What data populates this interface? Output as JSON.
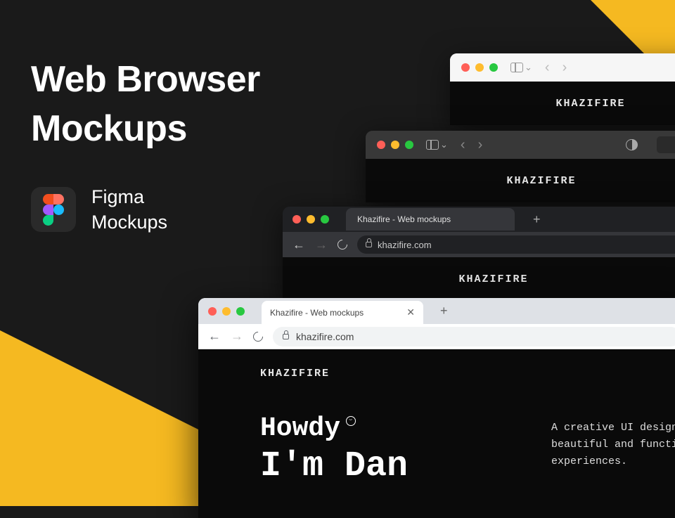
{
  "title_line1": "Web Browser",
  "title_line2": "Mockups",
  "figma": {
    "line1": "Figma",
    "line2": "Mockups"
  },
  "brand": "KHAZIFIRE",
  "safari_light": {
    "brand": "KHAZIFIRE"
  },
  "safari_dark": {
    "brand": "KHAZIFIRE"
  },
  "chrome_dark": {
    "tab_title": "Khazifire - Web mockups",
    "url": "khazifire.com",
    "brand": "KHAZIFIRE"
  },
  "chrome_light": {
    "tab_title": "Khazifire - Web mockups",
    "url": "khazifire.com",
    "brand": "KHAZIFIRE",
    "greeting": "Howdy",
    "intro": "I'm Dan",
    "tagline_line1": "A creative UI designer",
    "tagline_line2": "beautiful and functior",
    "tagline_line3": "experiences."
  }
}
